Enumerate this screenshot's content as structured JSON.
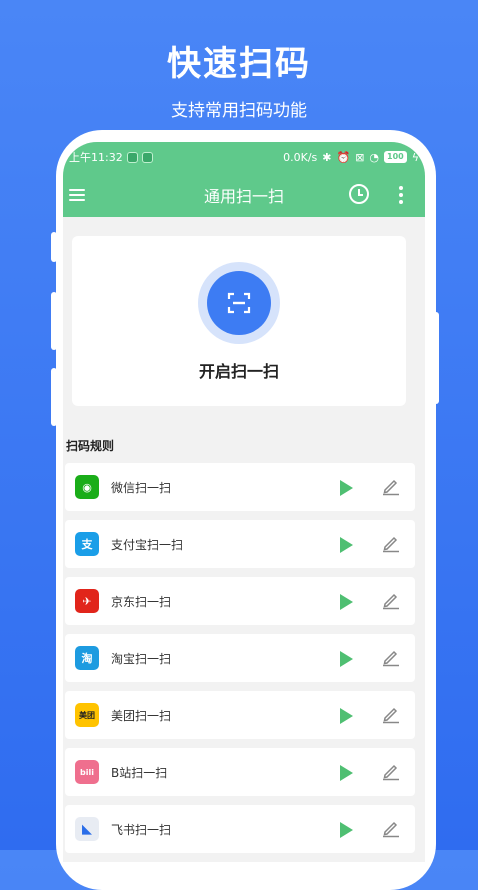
{
  "promo": {
    "title": "快速扫码",
    "subtitle": "支持常用扫码功能"
  },
  "status_bar": {
    "time": "上午11:32",
    "speed": "0.0K/s",
    "battery": "100"
  },
  "app_bar": {
    "title": "通用扫一扫",
    "menu_icon": "menu-icon",
    "history_icon": "history-icon",
    "more_icon": "more-vertical-icon"
  },
  "scan": {
    "label": "开启扫一扫",
    "icon": "scan-frame-icon"
  },
  "rules": {
    "heading": "扫码规则",
    "items": [
      {
        "label": "微信扫一扫",
        "icon": "wechat-icon",
        "color": "#1aad19",
        "glyph": "◉"
      },
      {
        "label": "支付宝扫一扫",
        "icon": "alipay-icon",
        "color": "#1a9ee8",
        "glyph": "支"
      },
      {
        "label": "京东扫一扫",
        "icon": "jd-icon",
        "color": "#e1251b",
        "glyph": "✈"
      },
      {
        "label": "淘宝扫一扫",
        "icon": "taobao-icon",
        "color": "#1d9be0",
        "glyph": "淘"
      },
      {
        "label": "美团扫一扫",
        "icon": "meituan-icon",
        "color": "#ffc300",
        "glyph": "美团"
      },
      {
        "label": "B站扫一扫",
        "icon": "bilibili-icon",
        "color": "#ef6f8e",
        "glyph": "bili"
      },
      {
        "label": "飞书扫一扫",
        "icon": "feishu-icon",
        "color": "#e8ecf3",
        "glyph": "◣"
      }
    ],
    "play_color": "#4fbf72"
  },
  "colors": {
    "background": "#3a78f2",
    "accent": "#5fc98b",
    "scan_button": "#3d7cf3"
  }
}
